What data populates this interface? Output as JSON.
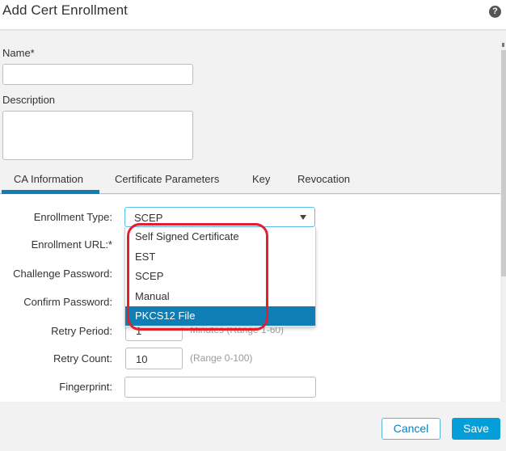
{
  "dialog": {
    "title": "Add Cert Enrollment",
    "help_icon": "question-circle-icon"
  },
  "fields": {
    "name_label": "Name*",
    "name_value": "",
    "description_label": "Description",
    "description_value": ""
  },
  "tabs": [
    {
      "label": "CA Information",
      "active": true
    },
    {
      "label": "Certificate Parameters",
      "active": false
    },
    {
      "label": "Key",
      "active": false
    },
    {
      "label": "Revocation",
      "active": false
    }
  ],
  "ca_info": {
    "enrollment_type_label": "Enrollment Type:",
    "enrollment_type_value": "SCEP",
    "enrollment_url_label": "Enrollment URL:*",
    "challenge_password_label": "Challenge Password:",
    "confirm_password_label": "Confirm Password:",
    "retry_period_label": "Retry Period:",
    "retry_period_value": "1",
    "retry_period_hint": "Minutes (Range 1-60)",
    "retry_count_label": "Retry Count:",
    "retry_count_value": "10",
    "retry_count_hint": "(Range 0-100)",
    "fingerprint_label": "Fingerprint:",
    "fingerprint_value": ""
  },
  "dropdown": {
    "options": [
      "Self Signed Certificate",
      "EST",
      "SCEP",
      "Manual",
      "PKCS12 File"
    ],
    "highlighted": "PKCS12 File"
  },
  "annotation": {
    "color": "#e2202c"
  },
  "footer": {
    "cancel_label": "Cancel",
    "save_label": "Save"
  },
  "colors": {
    "accent": "#0f7eb5",
    "primary_button": "#049fd9"
  }
}
